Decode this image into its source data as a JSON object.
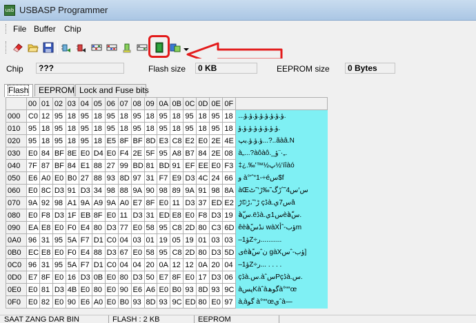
{
  "window": {
    "title": "USBASP Programmer",
    "app_icon_text": "usb"
  },
  "menu": {
    "items": [
      "File",
      "Buffer",
      "Chip"
    ]
  },
  "toolbar": {
    "buttons": [
      "eraser-icon",
      "open-folder-icon",
      "save-disk-icon",
      "chip-read-icon",
      "chip-write-icon",
      "chip-grid-icon",
      "chip-grid-verify-icon",
      "chip-flash-icon",
      "chip-grid-erase-icon",
      "green-chip-icon",
      "config-icon"
    ],
    "highlight_color": "#e31b1b",
    "arrow_color": "#e31b1b"
  },
  "chip_info": {
    "chip_label": "Chip",
    "chip_value": "???",
    "flash_label": "Flash size",
    "flash_value": "0 KB",
    "eeprom_label": "EEPROM size",
    "eeprom_value": "0 Bytes"
  },
  "tabs": [
    "Flash",
    "EEPROM",
    "Lock and Fuse bits"
  ],
  "hex_table": {
    "columns": [
      "00",
      "01",
      "02",
      "03",
      "04",
      "05",
      "06",
      "07",
      "08",
      "09",
      "0A",
      "0B",
      "0C",
      "0D",
      "0E",
      "0F"
    ],
    "rows": [
      {
        "addr": "000",
        "bytes": [
          "C0",
          "12",
          "95",
          "18",
          "95",
          "18",
          "95",
          "18",
          "95",
          "18",
          "95",
          "18",
          "95",
          "18",
          "95",
          "18"
        ],
        "ascii": "...ؤ.ؤ.ؤ.ؤ.ؤ.ؤ.ؤ.ؤ."
      },
      {
        "addr": "010",
        "bytes": [
          "95",
          "18",
          "95",
          "18",
          "95",
          "18",
          "95",
          "18",
          "95",
          "18",
          "95",
          "18",
          "95",
          "18",
          "95",
          "18"
        ],
        "ascii": "ؤ.ؤ.ؤ.ؤ.ؤ.ؤ.ؤ.ؤ."
      },
      {
        "addr": "020",
        "bytes": [
          "95",
          "18",
          "95",
          "18",
          "95",
          "18",
          "E5",
          "8F",
          "BF",
          "8D",
          "E3",
          "C8",
          "E2",
          "E0",
          "2E",
          "4E"
        ],
        "ascii": "ؤ.ؤ.ؤ.بپ...?..ãàâ.N"
      },
      {
        "addr": "030",
        "bytes": [
          "E0",
          "84",
          "BF",
          "8E",
          "E0",
          "D4",
          "E0",
          "F4",
          "2E",
          "5F",
          "95",
          "A8",
          "B7",
          "84",
          "2E",
          "08"
        ],
        "ascii": "à„...?à‌ôàô._ؤ¨·„."
      },
      {
        "addr": "040",
        "bytes": [
          "7F",
          "87",
          "BF",
          "84",
          "E1",
          "88",
          "27",
          "99",
          "BD",
          "81",
          "BD",
          "91",
          "EF",
          "EE",
          "E0",
          "F3"
        ],
        "ascii": "‡¿.‰'™½پ½‘ïîàó"
      },
      {
        "addr": "050",
        "bytes": [
          "E6",
          "A0",
          "E0",
          "B0",
          "27",
          "88",
          "93",
          "8D",
          "97",
          "31",
          "F7",
          "E9",
          "D3",
          "4C",
          "24",
          "66"
        ],
        "ascii": "و à°'ˆ“1-÷éس$f"
      },
      {
        "addr": "060",
        "bytes": [
          "E0",
          "8C",
          "D3",
          "91",
          "D3",
          "34",
          "98",
          "88",
          "9A",
          "90",
          "98",
          "89",
          "9A",
          "91",
          "98",
          "8A"
        ],
        "ascii": "àŒس‘س4˜ˆڑگ˜‰ڑ‘˜ٹ"
      },
      {
        "addr": "070",
        "bytes": [
          "9A",
          "92",
          "98",
          "A1",
          "9A",
          "A9",
          "9A",
          "A0",
          "E7",
          "8F",
          "E0",
          "11",
          "D3",
          "37",
          "ED",
          "E2"
        ],
        "ascii": "ڑ’˜،ڑ©ڑ çڈà.س7يâ"
      },
      {
        "addr": "080",
        "bytes": [
          "E0",
          "F8",
          "D3",
          "1F",
          "EB",
          "8F",
          "E0",
          "11",
          "D3",
          "31",
          "ED",
          "E8",
          "E0",
          "F8",
          "D3",
          "19"
        ],
        "ascii": "àّس.ëڈà.س1يèàّس."
      },
      {
        "addr": "090",
        "bytes": [
          "EA",
          "E8",
          "E0",
          "F0",
          "E4",
          "80",
          "D3",
          "77",
          "E0",
          "58",
          "95",
          "C8",
          "2D",
          "80",
          "C3",
          "6D"
        ],
        "ascii": "êèàًنڈس wàXؤب-ˆأm"
      },
      {
        "addr": "0A0",
        "bytes": [
          "96",
          "31",
          "95",
          "5A",
          "F7",
          "D1",
          "C0",
          "04",
          "03",
          "01",
          "19",
          "05",
          "19",
          "01",
          "03",
          "03"
        ],
        "ascii": "–1ؤZ÷ر..........."
      },
      {
        "addr": "0B0",
        "bytes": [
          "EC",
          "E8",
          "E0",
          "F0",
          "E4",
          "88",
          "D3",
          "67",
          "E0",
          "58",
          "95",
          "C8",
          "2D",
          "80",
          "D3",
          "5D"
        ],
        "ascii": "ىèàًنˆس gàXؤب-ˆس]"
      },
      {
        "addr": "0C0",
        "bytes": [
          "96",
          "31",
          "95",
          "5A",
          "F7",
          "D1",
          "C0",
          "04",
          "04",
          "20",
          "0A",
          "12",
          "12",
          "0A",
          "20",
          "04"
        ],
        "ascii": "–1ؤZ÷ر... . . . ."
      },
      {
        "addr": "0D0",
        "bytes": [
          "E7",
          "8F",
          "E0",
          "16",
          "D3",
          "0B",
          "E0",
          "80",
          "D3",
          "50",
          "E7",
          "8F",
          "E0",
          "17",
          "D3",
          "06"
        ],
        "ascii": "çڈà.س.àˆسPçڈà.س."
      },
      {
        "addr": "0E0",
        "bytes": [
          "E0",
          "81",
          "D3",
          "4B",
          "E0",
          "80",
          "E0",
          "90",
          "E6",
          "A6",
          "E0",
          "B0",
          "93",
          "8D",
          "93",
          "9C"
        ],
        "ascii": "àپسKàˆàگوھà°““œ"
      },
      {
        "addr": "0F0",
        "bytes": [
          "E0",
          "82",
          "E0",
          "90",
          "E6",
          "A0",
          "E0",
          "B0",
          "93",
          "8D",
          "93",
          "9C",
          "ED",
          "80",
          "E0",
          "97"
        ],
        "ascii": "à‚àگو à°““œيˆà—"
      }
    ]
  },
  "status": [
    "SAAT ZANG DAR BIN",
    "FLASH : 2 KB",
    "EEPROM"
  ]
}
